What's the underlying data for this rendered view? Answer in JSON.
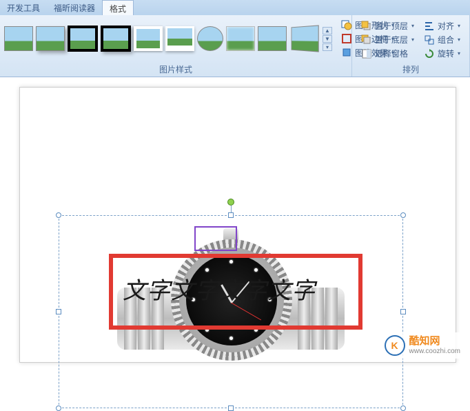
{
  "tabs": {
    "dev": "开发工具",
    "foxit": "福昕阅读器",
    "format": "格式"
  },
  "ribbon": {
    "styles_label": "图片样式",
    "arrange_label": "排列",
    "pic_shape": "图片形状",
    "pic_border": "图片边框",
    "pic_effects": "图片效果",
    "bring_front": "置于顶层",
    "send_back": "置于底层",
    "selection_pane": "选择窗格",
    "align": "对齐",
    "group": "组合",
    "rotate": "旋转"
  },
  "canvas": {
    "overlay_text": "文字文字文字文字"
  },
  "watermark": {
    "logo": "K",
    "cn": "酷知网",
    "url": "www.coozhi.com"
  }
}
